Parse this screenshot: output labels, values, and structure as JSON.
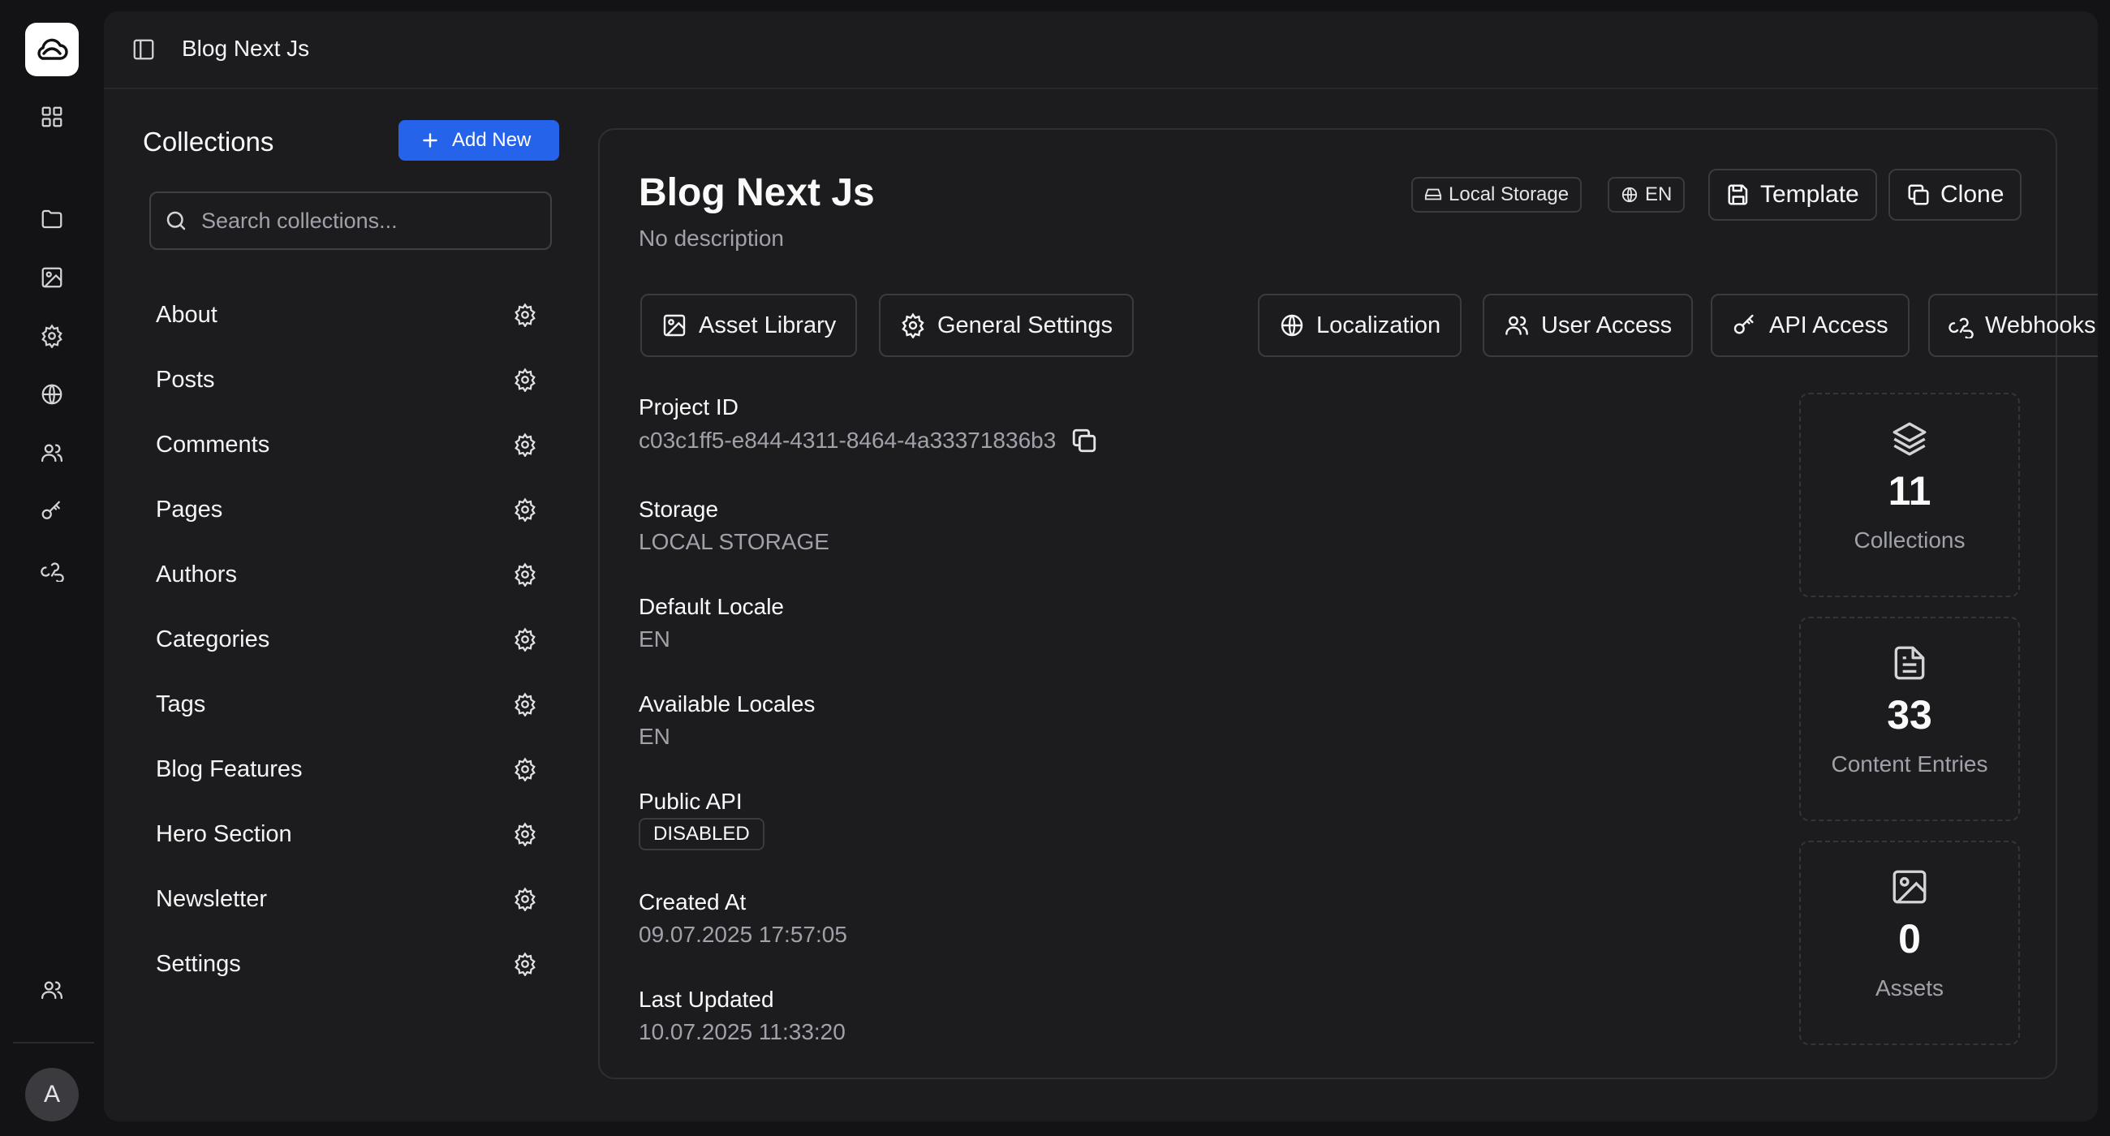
{
  "topbar": {
    "title": "Blog Next Js"
  },
  "rail": {
    "icons": [
      "dashboard-icon",
      "folder-icon",
      "image-icon",
      "settings-icon",
      "globe-icon",
      "users-icon",
      "key-icon",
      "webhook-icon",
      "team-icon"
    ],
    "avatar_initial": "A"
  },
  "collections": {
    "title": "Collections",
    "add_label": "Add New",
    "search_placeholder": "Search collections...",
    "items": [
      "About",
      "Posts",
      "Comments",
      "Pages",
      "Authors",
      "Categories",
      "Tags",
      "Blog Features",
      "Hero Section",
      "Newsletter",
      "Settings"
    ]
  },
  "project": {
    "name": "Blog Next Js",
    "description": "No description",
    "badges": {
      "storage": "Local Storage",
      "locale": "EN"
    },
    "buttons": {
      "template": "Template",
      "clone": "Clone"
    },
    "tabs": [
      "Asset Library",
      "General Settings",
      "Localization",
      "User Access",
      "API Access",
      "Webhooks"
    ],
    "fields": {
      "project_id_label": "Project ID",
      "project_id": "c03c1ff5-e844-4311-8464-4a33371836b3",
      "storage_label": "Storage",
      "storage": "LOCAL STORAGE",
      "default_locale_label": "Default Locale",
      "default_locale": "EN",
      "available_locales_label": "Available Locales",
      "available_locales": "EN",
      "public_api_label": "Public API",
      "public_api": "DISABLED",
      "created_label": "Created At",
      "created": "09.07.2025 17:57:05",
      "updated_label": "Last Updated",
      "updated": "10.07.2025 11:33:20"
    },
    "stats": [
      {
        "value": "11",
        "label": "Collections",
        "icon": "layers-icon"
      },
      {
        "value": "33",
        "label": "Content Entries",
        "icon": "file-text-icon"
      },
      {
        "value": "0",
        "label": "Assets",
        "icon": "image-icon"
      }
    ]
  },
  "colors": {
    "accent": "#2563eb",
    "background": "#131316",
    "panel": "#1c1c1f"
  }
}
